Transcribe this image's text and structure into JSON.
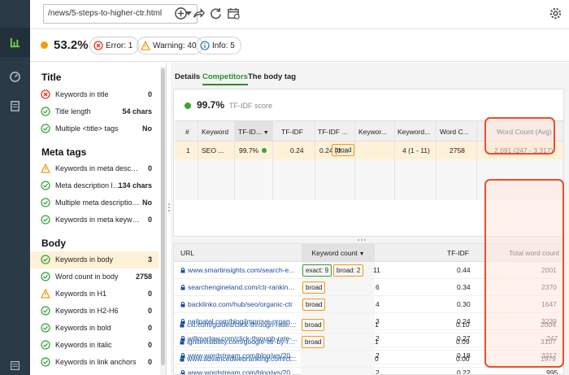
{
  "toolbar": {
    "url_value": "/news/5-steps-to-higher-ctr.html"
  },
  "icons": {
    "rail": [
      "bar-chart-icon",
      "gauge-icon",
      "document-icon",
      "list-icon"
    ],
    "toolbar": [
      "add-circle-icon",
      "share-arrow-icon",
      "refresh-icon",
      "calendar-icon",
      "settings-gear-icon"
    ]
  },
  "colors": {
    "accent_green": "#2e8b2e",
    "warning_orange": "#f39c12",
    "error_red": "#e0352b",
    "highlight": "#e8502a",
    "selected_row": "#fdf1d8"
  },
  "score": {
    "value": "53.2%",
    "error_label": "Error: 1",
    "warning_label": "Warning: 40",
    "info_label": "Info: 5"
  },
  "sidebar": {
    "sections": [
      {
        "title": "Title",
        "items": [
          {
            "label": "Keywords in title",
            "value": "0",
            "status": "error"
          },
          {
            "label": "Title length",
            "value": "54 chars",
            "status": "ok"
          },
          {
            "label": "Multiple <title> tags",
            "value": "No",
            "status": "ok"
          }
        ]
      },
      {
        "title": "Meta tags",
        "items": [
          {
            "label": "Keywords in meta description",
            "value": "0",
            "status": "warning"
          },
          {
            "label": "Meta description length",
            "value": "134 chars",
            "status": "ok"
          },
          {
            "label": "Multiple meta description tags",
            "value": "No",
            "status": "ok"
          },
          {
            "label": "Keywords in meta keywords",
            "value": "0",
            "status": "ok"
          }
        ]
      },
      {
        "title": "Body",
        "items": [
          {
            "label": "Keywords in body",
            "value": "3",
            "status": "ok",
            "selected": true
          },
          {
            "label": "Word count in body",
            "value": "2758",
            "status": "ok"
          },
          {
            "label": "Keywords in H1",
            "value": "0",
            "status": "warning"
          },
          {
            "label": "Keywords in H2-H6",
            "value": "0",
            "status": "ok"
          },
          {
            "label": "Keywords in bold",
            "value": "0",
            "status": "ok"
          },
          {
            "label": "Keywords in italic",
            "value": "0",
            "status": "ok"
          },
          {
            "label": "Keywords in link anchors",
            "value": "0",
            "status": "ok"
          }
        ]
      }
    ]
  },
  "tabs": [
    "Details",
    "Competitors",
    "The body tag"
  ],
  "tfidf": {
    "value": "99.7%",
    "label": "TF-IDF score"
  },
  "competitors": {
    "headers": [
      "#",
      "Keyword",
      "TF-ID...",
      "TF-IDF",
      "TF-IDF ...",
      "Keywor...",
      "Keyword...",
      "Word C...",
      "Word Count (Avg)"
    ],
    "row": [
      "1",
      "SEO ...",
      "99.7%",
      "0.24",
      "0.24 (0....",
      "broad",
      "4 (1 - 11)",
      "2758",
      "2,091 (247 - 3,317)"
    ]
  },
  "url_table": {
    "headers": [
      "URL",
      "Keyword count",
      "TF-IDF",
      "Total word count"
    ],
    "rows": [
      {
        "url": "www.smartinsights.com/search-e...",
        "badges": [
          "exact: 9",
          "broad: 2"
        ],
        "kw": "11",
        "tfidf": "0.44",
        "words": "2001"
      },
      {
        "url": "searchengineland.com/ctr-ranking-...",
        "badges": [
          "broad"
        ],
        "kw": "6",
        "tfidf": "0.34",
        "words": "2370"
      },
      {
        "url": "backlinko.com/hub/seo/organic-ctr",
        "badges": [
          "broad"
        ],
        "kw": "4",
        "tfidf": "0.30",
        "words": "1647"
      },
      {
        "url": "neilpatel.com/blog/improve-organic...",
        "badges": [
          "broad"
        ],
        "kw": "3",
        "tfidf": "0.24",
        "words": "3239"
      },
      {
        "url": "willmarlow.com/click-through-rate-...",
        "badges": [
          "broad"
        ],
        "kw": "2",
        "tfidf": "0.27",
        "words": "247"
      },
      {
        "url": "www.wordstream.com/blog/ws/20...",
        "badges": [
          "broad"
        ],
        "kw": "2",
        "tfidf": "0.18",
        "words": "3317"
      },
      {
        "url": "www.wordstream.com/blog/ws/20...",
        "badges": [
          "broad"
        ],
        "kw": "2",
        "tfidf": "0.22",
        "words": "995"
      },
      {
        "url": "cxl.com/guides/click-through-rate/...",
        "badges": [
          "broad"
        ],
        "kw": "1",
        "tfidf": "0.10",
        "words": "2004"
      },
      {
        "url": "ignitevisibility.com/google-ctr-by-ra...",
        "badges": [
          "broad"
        ],
        "kw": "1",
        "tfidf": "0.09",
        "words": "3107"
      },
      {
        "url": "www.advancedwebranking.com/ct...",
        "badges": [],
        "kw": "0",
        "tfidf": "0.00",
        "words": "1979"
      }
    ]
  }
}
